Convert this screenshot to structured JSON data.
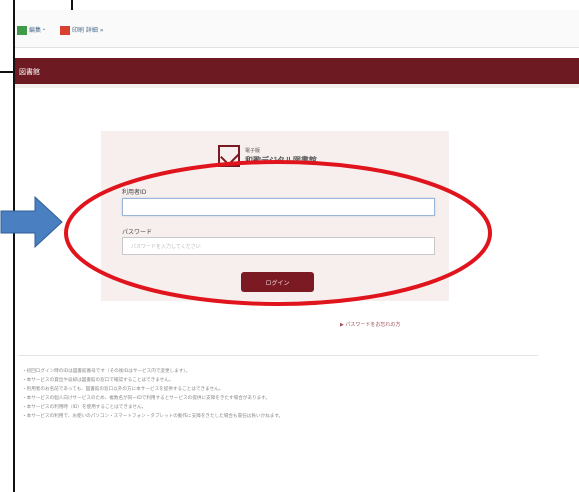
{
  "toolbar": {
    "items": [
      {
        "icon": "page-icon",
        "label": "編集・"
      },
      {
        "icon": "tool-icon",
        "label": "印刷  詳細 »"
      }
    ]
  },
  "site": {
    "title": "図書館",
    "accent_color": "#6e1a22"
  },
  "login": {
    "logo_small": "電子版",
    "logo_text": "和歌デジタル図書館",
    "id_label": "利用者ID",
    "id_value": "",
    "password_label": "パスワード",
    "password_placeholder": "パスワードを入力してください",
    "submit_label": "ログイン"
  },
  "forgot_password": "▶ パスワードをお忘れの方",
  "notes": [
    "・初回ログイン時のIDは図書館番号です（その後IDはサービス内で変更します）。",
    "・本サービスの貸出や返却は図書館の窓口で確認することはできません。",
    "・利用者のお名前であっても、図書館の窓口以外の方に本サービスを提供することはできません。",
    "・本サービスの個人向けサービスのため、複数名が同一IDで利用するとサービスの提供に支障をきたす場合があります。",
    "・本サービスの利用時（ID）を使用することはできません。",
    "・本サービスの利用で、お使いのパソコン・スマートフォン・タブレットの動作に支障をきたした場合も責任は負いかねます。"
  ],
  "annotation_colors": {
    "arrow": "#4a7fc1",
    "ellipse": "#e0141c"
  }
}
